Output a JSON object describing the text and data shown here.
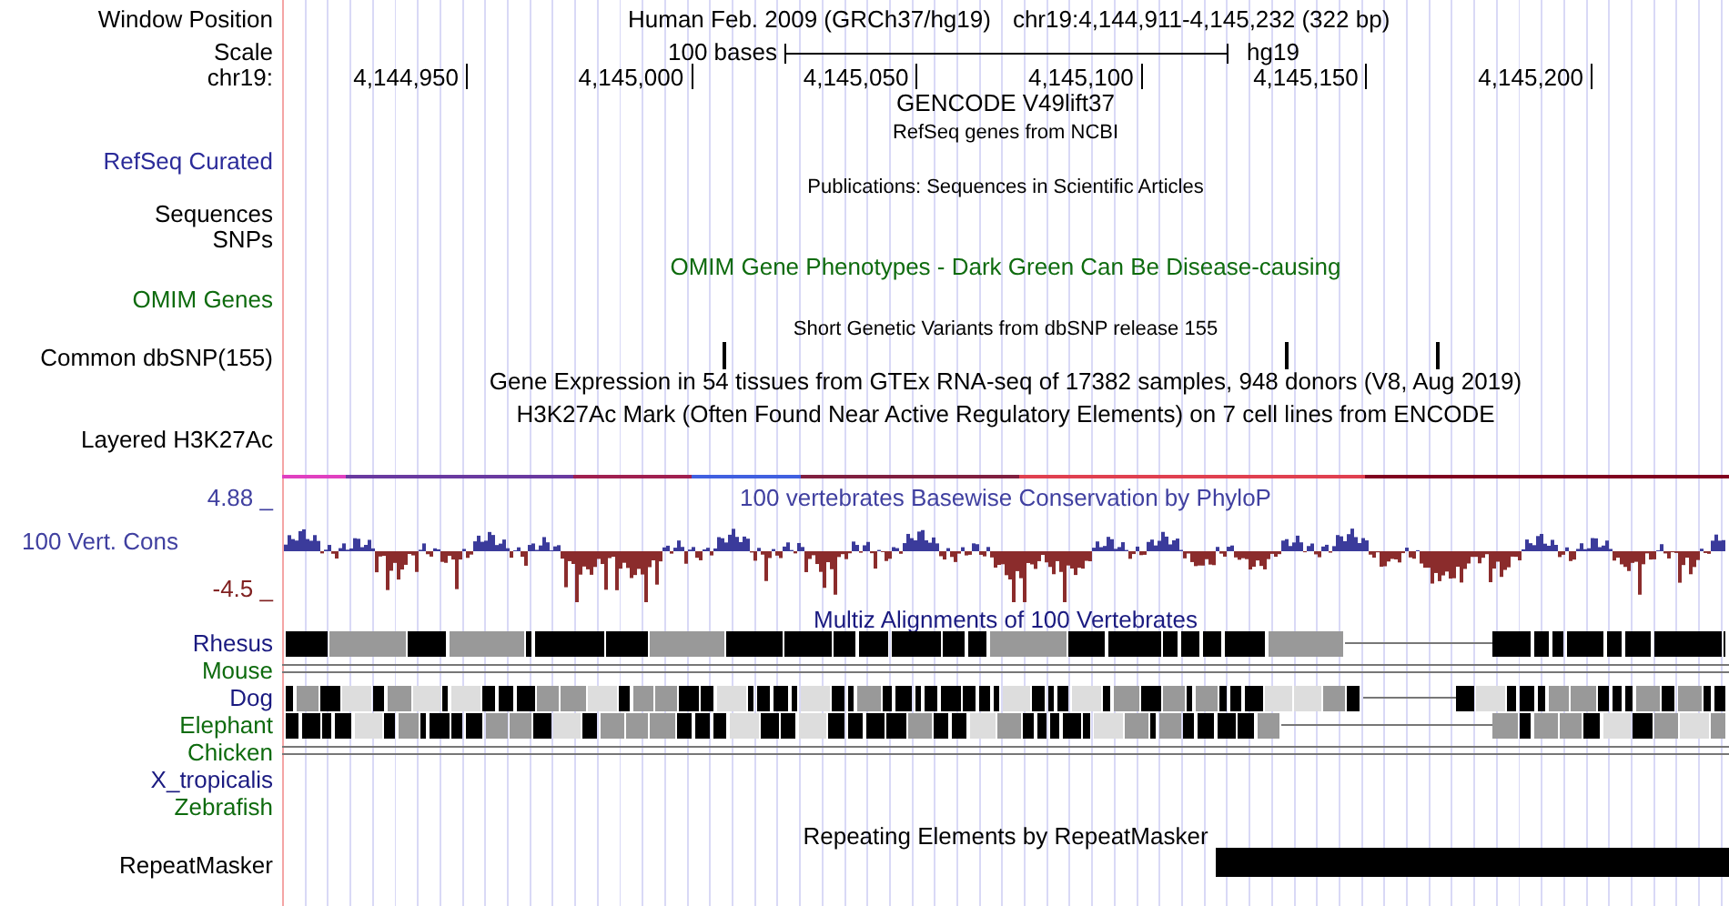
{
  "header": {
    "window_position_label": "Window Position",
    "assembly": "Human Feb. 2009 (GRCh37/hg19)",
    "position": "chr19:4,144,911-4,145,232 (322 bp)",
    "scale_label": "Scale",
    "scale_length": "100 bases",
    "scale_assembly": "hg19",
    "chrom_label": "chr19:",
    "ruler_ticks": [
      "4,144,950",
      "4,145,000",
      "4,145,050",
      "4,145,100",
      "4,145,150",
      "4,145,200"
    ]
  },
  "tracks": [
    {
      "kind": "title",
      "title": "GENCODE V49lift37",
      "color": "#000000"
    },
    {
      "kind": "subtitle",
      "title": "RefSeq genes from NCBI",
      "color": "#000000"
    },
    {
      "kind": "label",
      "label": "RefSeq Curated",
      "color": "#2b2b99"
    },
    {
      "kind": "subtitle",
      "title": "Publications: Sequences in Scientific Articles",
      "color": "#000000"
    },
    {
      "kind": "label",
      "label": "Sequences",
      "color": "#000000"
    },
    {
      "kind": "label",
      "label": "SNPs",
      "color": "#000000"
    },
    {
      "kind": "title",
      "title": "OMIM Gene Phenotypes - Dark Green Can Be Disease-causing",
      "color": "#0e6b0e"
    },
    {
      "kind": "label",
      "label": "OMIM Genes",
      "color": "#0e6b0e"
    },
    {
      "kind": "subtitle",
      "title": "Short Genetic Variants from dbSNP release 155",
      "color": "#000000"
    },
    {
      "kind": "snp",
      "label": "Common dbSNP(155)",
      "color": "#000000"
    },
    {
      "kind": "title",
      "title": "Gene Expression in 54 tissues from GTEx RNA-seq of 17382 samples, 948 donors (V8, Aug 2019)",
      "color": "#000000"
    },
    {
      "kind": "title",
      "title": "H3K27Ac Mark (Often Found Near Active Regulatory Elements) on 7 cell lines from ENCODE",
      "color": "#000000"
    },
    {
      "kind": "layered",
      "label": "Layered H3K27Ac",
      "color": "#000000"
    },
    {
      "kind": "conservation",
      "label": "100 Vert. Cons",
      "color": "#4040a0",
      "max": "4.88 _",
      "min": "-4.5 _",
      "title": "100 vertebrates Basewise Conservation by PhyloP"
    },
    {
      "kind": "title",
      "title": "Multiz Alignments of 100 Vertebrates",
      "color": "#1a1a80"
    },
    {
      "kind": "blocks",
      "label": "Rhesus",
      "color": "#1a1a80"
    },
    {
      "kind": "double-line",
      "label": "Mouse",
      "color": "#0e6b0e"
    },
    {
      "kind": "blocks",
      "label": "Dog",
      "color": "#1a1a80"
    },
    {
      "kind": "blocks",
      "label": "Elephant",
      "color": "#0e6b0e"
    },
    {
      "kind": "double-line",
      "label": "Chicken",
      "color": "#0e6b0e"
    },
    {
      "kind": "label",
      "label": "X_tropicalis",
      "color": "#1a1a80"
    },
    {
      "kind": "label",
      "label": "Zebrafish",
      "color": "#0e6b0e"
    },
    {
      "kind": "subtitle-large",
      "title": "Repeating Elements by RepeatMasker",
      "color": "#000000"
    },
    {
      "kind": "repeat",
      "label": "RepeatMasker",
      "color": "#000000"
    }
  ]
}
